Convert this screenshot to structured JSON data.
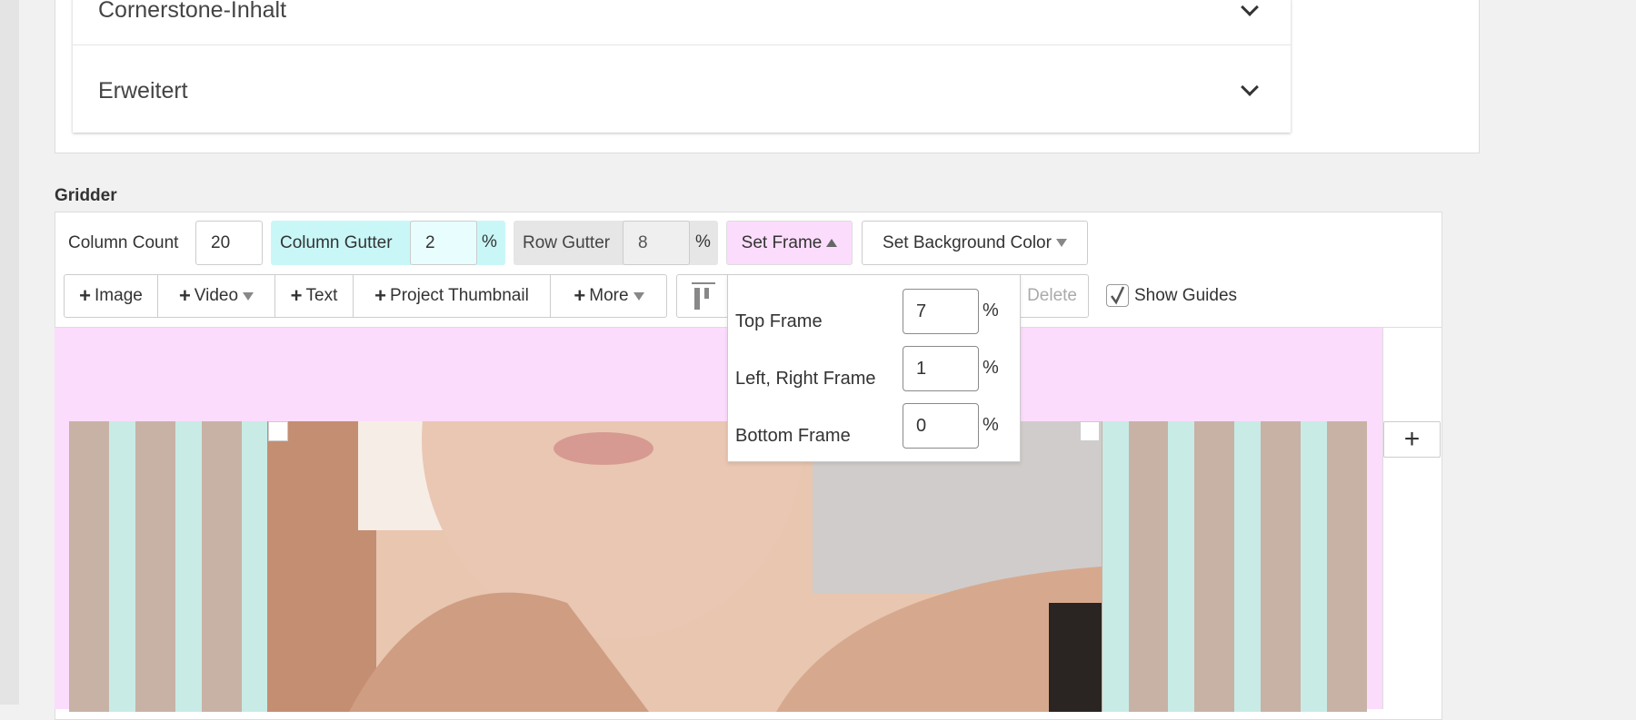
{
  "accordion": [
    {
      "label": "Cornerstone-Inhalt",
      "icon": "chevron-down-icon"
    },
    {
      "label": "Erweitert",
      "icon": "chevron-down-icon"
    }
  ],
  "gridder": {
    "title": "Gridder",
    "column_count": {
      "label": "Column Count",
      "value": "20"
    },
    "column_gutter": {
      "label": "Column Gutter",
      "value": "2",
      "unit": "%"
    },
    "row_gutter": {
      "label": "Row Gutter",
      "value": "8",
      "unit": "%"
    },
    "set_frame": "Set Frame",
    "set_background_color": "Set Background Color",
    "add_buttons": [
      "Image",
      "Video",
      "Text",
      "Project Thumbnail",
      "More"
    ],
    "delete": "Delete",
    "show_guides": {
      "label": "Show Guides",
      "checked": true
    },
    "frame_popup": {
      "top": {
        "label": "Top Frame",
        "value": "7",
        "unit": "%"
      },
      "left_right": {
        "label": "Left, Right Frame",
        "value": "1",
        "unit": "%"
      },
      "bottom": {
        "label": "Bottom Frame",
        "value": "0",
        "unit": "%"
      }
    },
    "add_row": "+"
  },
  "colors": {
    "canvas": "#fcdcfc",
    "guide_column": "#c8b2a6",
    "guide_gutter": "#c8ebe6",
    "column_gutter_bg": "#c9f7f8",
    "row_gutter_bg": "#e6e6e6",
    "set_frame_bg": "#fcdcfc"
  }
}
